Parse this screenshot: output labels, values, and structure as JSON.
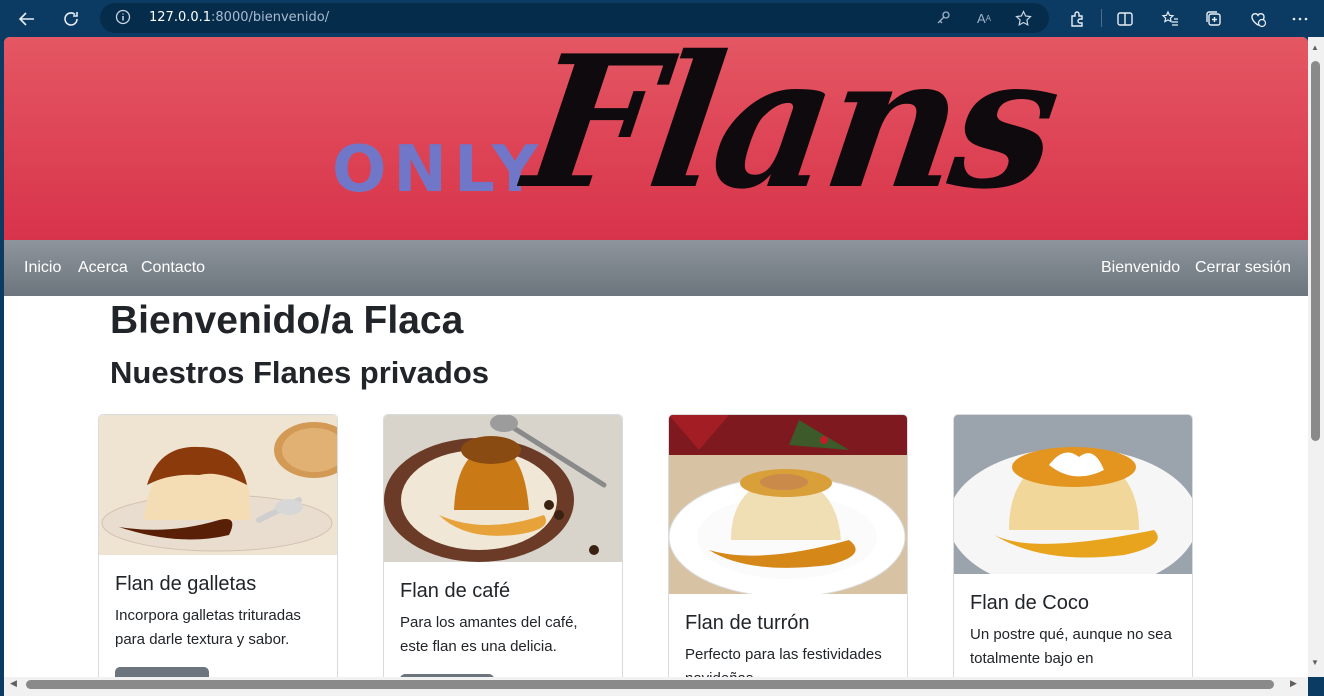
{
  "browser": {
    "url_host": "127.0.0.1",
    "url_path": ":8000/bienvenido/"
  },
  "banner": {
    "logo_small": "ONLY",
    "logo_big": "Flans"
  },
  "navbar": {
    "left_links": [
      "Inicio",
      "Acerca",
      "Contacto"
    ],
    "right_links": [
      "Bienvenido",
      "Cerrar sesión"
    ]
  },
  "main": {
    "welcome_title": "Bienvenido/a Flaca",
    "section_title": "Nuestros Flanes privados"
  },
  "cards": [
    {
      "title": "Flan de galletas",
      "text": "Incorpora galletas trituradas para darle textura y sabor.",
      "image": "flan-galletas-photo"
    },
    {
      "title": "Flan de café",
      "text": "Para los amantes del café, este flan es una delicia.",
      "image": "flan-cafe-photo"
    },
    {
      "title": "Flan de turrón",
      "text": "Perfecto para las festividades navideñas.",
      "image": "flan-turron-photo"
    },
    {
      "title": "Flan de Coco",
      "text": "Un postre qué, aunque no sea totalmente bajo en",
      "image": "flan-coco-photo"
    }
  ],
  "colors": {
    "banner_top": "#e45763",
    "banner_bottom": "#d8334a",
    "logo_only": "#7077c8",
    "navbar": "#6c757d",
    "browser_chrome": "#0b3b63"
  }
}
